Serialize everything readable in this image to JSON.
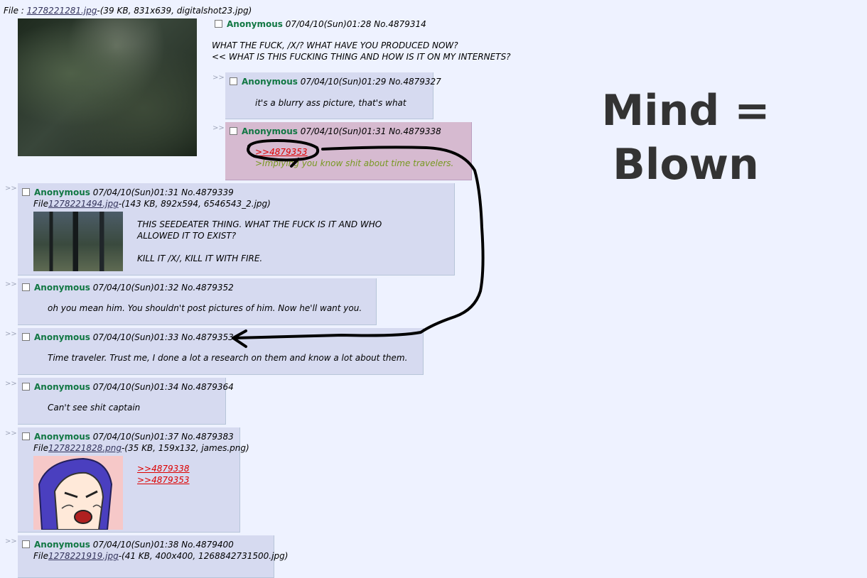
{
  "op": {
    "file_label": "File :",
    "file_link": "1278221281.jpg",
    "file_info": "-(39 KB, 831x639, digitalshot23.jpg)",
    "name": "Anonymous",
    "meta": "07/04/10(Sun)01:28 No.4879314",
    "body_line1": "WHAT THE FUCK, /X/? WHAT HAVE YOU PRODUCED NOW?",
    "body_line2": "<< WHAT IS THIS FUCKING THING AND HOW IS IT ON MY INTERNETS?"
  },
  "reply_arrows": ">>",
  "replies": [
    {
      "name": "Anonymous",
      "meta": "07/04/10(Sun)01:29 No.4879327",
      "text": "it's a blurry ass picture, that's what"
    },
    {
      "name": "Anonymous",
      "meta": "07/04/10(Sun)01:31 No.4879338",
      "quote": ">>4879353",
      "greentext": ">Implying you know shit about time travelers."
    },
    {
      "name": "Anonymous",
      "meta": "07/04/10(Sun)01:31 No.4879339",
      "file_label": "File",
      "file_link": "1278221494.jpg",
      "file_info": "-(143 KB, 892x594, 6546543_2.jpg)",
      "text1": "THIS SEEDEATER THING. WHAT THE FUCK IS IT AND WHO",
      "text2": "ALLOWED IT TO EXIST?",
      "text3": "KILL IT /X/, KILL IT WITH FIRE."
    },
    {
      "name": "Anonymous",
      "meta": "07/04/10(Sun)01:32 No.4879352",
      "text": "oh you mean him. You shouldn't post pictures of him. Now he'll want you."
    },
    {
      "name": "Anonymous",
      "meta": "07/04/10(Sun)01:33 No.4879353",
      "text": "Time traveler. Trust me, I done a lot a research on them and know a lot about them."
    },
    {
      "name": "Anonymous",
      "meta": "07/04/10(Sun)01:34 No.4879364",
      "text": "Can't see shit captain"
    },
    {
      "name": "Anonymous",
      "meta": "07/04/10(Sun)01:37 No.4879383",
      "file_label": "File",
      "file_link": "1278221828.png",
      "file_info": "-(35 KB, 159x132, james.png)",
      "quote1": ">>4879338",
      "quote2": ">>4879353"
    },
    {
      "name": "Anonymous",
      "meta": "07/04/10(Sun)01:38 No.4879400",
      "file_label": "File",
      "file_link": "1278221919.jpg",
      "file_info": "-(41 KB, 400x400, 1268842731500.jpg)"
    }
  ],
  "caption_line1": "Mind =",
  "caption_line2": "Blown"
}
